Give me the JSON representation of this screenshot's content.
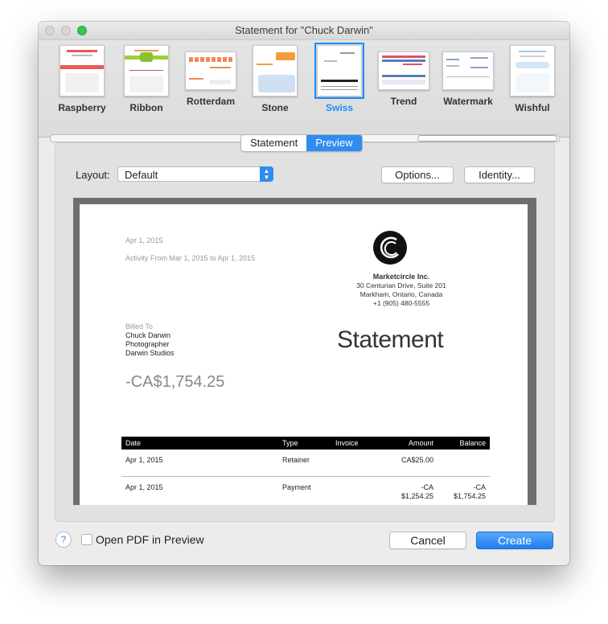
{
  "window": {
    "title": "Statement for \"Chuck Darwin\""
  },
  "templates": [
    {
      "label": "Raspberry",
      "selected": false
    },
    {
      "label": "Ribbon",
      "selected": false
    },
    {
      "label": "Rotterdam",
      "selected": false
    },
    {
      "label": "Stone",
      "selected": false
    },
    {
      "label": "Swiss",
      "selected": true
    },
    {
      "label": "Trend",
      "selected": false
    },
    {
      "label": "Watermark",
      "selected": false
    },
    {
      "label": "Wishful",
      "selected": false
    }
  ],
  "tabs": {
    "statement": "Statement",
    "preview": "Preview",
    "active": "Preview"
  },
  "layout": {
    "label": "Layout:",
    "value": "Default"
  },
  "buttons": {
    "options": "Options...",
    "identity": "Identity...",
    "cancel": "Cancel",
    "create": "Create",
    "help": "?"
  },
  "footer": {
    "open_pdf_label": "Open PDF in Preview",
    "open_pdf_checked": false
  },
  "statement": {
    "date": "Apr 1, 2015",
    "activity": "Activity From Mar 1, 2015 to Apr 1, 2015",
    "company": {
      "name": "Marketcircle Inc.",
      "address1": "30 Centurian Drive, Suite 201",
      "address2": "Markham, Ontario, Canada",
      "phone": "+1 (905) 480-5555"
    },
    "billed_to": {
      "label": "Billed To",
      "name": "Chuck Darwin",
      "title": "Photographer",
      "company": "Darwin Studios"
    },
    "title": "Statement",
    "total": "-CA$1,754.25",
    "table": {
      "headers": {
        "date": "Date",
        "type": "Type",
        "invoice": "Invoice",
        "amount": "Amount",
        "balance": "Balance"
      },
      "rows": [
        {
          "date": "Apr 1, 2015",
          "type": "Retainer",
          "invoice": "",
          "amount": "CA$25.00",
          "amount2": "",
          "balance": "",
          "balance2": ""
        },
        {
          "date": "Apr 1, 2015",
          "type": "Payment",
          "invoice": "",
          "amount": "-CA",
          "amount2": "$1,254.25",
          "balance": "-CA",
          "balance2": "$1,754.25"
        }
      ]
    }
  },
  "colors": {
    "accent": "#2f8cf0",
    "selected_template": "#1a8cff"
  }
}
